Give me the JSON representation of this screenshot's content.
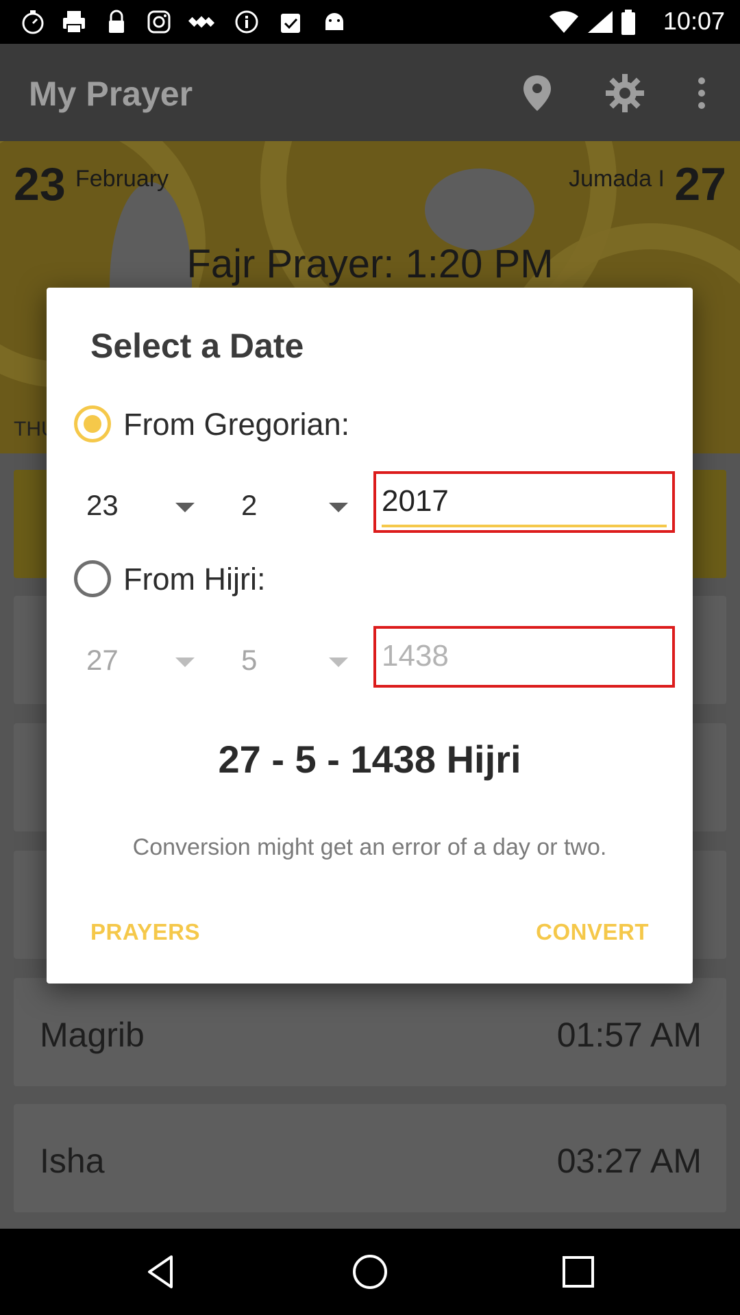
{
  "status_bar": {
    "time": "10:07",
    "left_icons": [
      "stopwatch-icon",
      "printer-icon",
      "lock-icon",
      "instagram-icon",
      "fake-gps-icon",
      "info-icon",
      "clipboard-check-icon",
      "android-icon"
    ],
    "right_icons": [
      "wifi-icon",
      "signal-icon",
      "battery-icon"
    ]
  },
  "app_bar": {
    "title": "My Prayer",
    "actions": [
      "location-icon",
      "settings-icon",
      "more-vert-icon"
    ]
  },
  "background": {
    "gregorian_day": "23",
    "gregorian_month": "February",
    "hijri_month": "Jumada I",
    "hijri_day": "27",
    "next_prayer": "Fajr Prayer: 1:20 PM",
    "day_label": "THU",
    "prayers": [
      {
        "name": "Magrib",
        "time": "01:57 AM"
      },
      {
        "name": "Isha",
        "time": "03:27 AM"
      }
    ]
  },
  "dialog": {
    "title": "Select a Date",
    "gregorian": {
      "label": "From Gregorian:",
      "selected": true,
      "day": "23",
      "month": "2",
      "year": "2017"
    },
    "hijri": {
      "label": "From Hijri:",
      "selected": false,
      "day": "27",
      "month": "5",
      "year": "1438"
    },
    "result": "27 - 5 - 1438 Hijri",
    "note": "Conversion might get an error of a day or two.",
    "buttons": {
      "left": "PRAYERS",
      "right": "CONVERT"
    }
  },
  "colors": {
    "accent": "#f5c84a",
    "error_border": "#dc1c1c",
    "app_bar": "#3a3a3a"
  }
}
